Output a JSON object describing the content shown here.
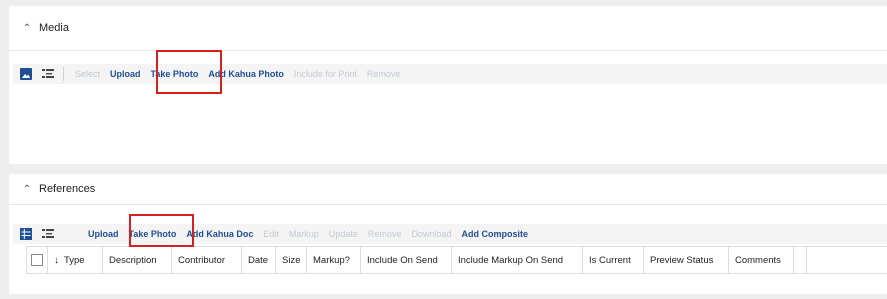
{
  "media": {
    "title": "Media",
    "toolbar": [
      {
        "label": "Select",
        "enabled": false,
        "bold": false
      },
      {
        "label": "Upload",
        "enabled": true,
        "bold": true
      },
      {
        "label": "Take Photo",
        "enabled": true,
        "bold": true
      },
      {
        "label": "Add Kahua Photo",
        "enabled": true,
        "bold": true
      },
      {
        "label": "Include for Print",
        "enabled": false,
        "bold": false
      },
      {
        "label": "Remove",
        "enabled": false,
        "bold": false
      }
    ]
  },
  "references": {
    "title": "References",
    "toolbar": [
      {
        "label": "Upload",
        "enabled": true,
        "bold": true
      },
      {
        "label": "Take Photo",
        "enabled": true,
        "bold": true
      },
      {
        "label": "Add Kahua Doc",
        "enabled": true,
        "bold": true
      },
      {
        "label": "Edit",
        "enabled": false,
        "bold": false
      },
      {
        "label": "Markup",
        "enabled": false,
        "bold": false
      },
      {
        "label": "Update",
        "enabled": false,
        "bold": false
      },
      {
        "label": "Remove",
        "enabled": false,
        "bold": false
      },
      {
        "label": "Download",
        "enabled": false,
        "bold": false
      },
      {
        "label": "Add Composite",
        "enabled": true,
        "bold": true
      }
    ],
    "columns": [
      "Type",
      "Description",
      "Contributor",
      "Date",
      "Size",
      "Markup?",
      "Include On Send",
      "Include Markup On Send",
      "Is Current",
      "Preview Status",
      "Comments",
      ""
    ]
  },
  "colors": {
    "link": "#1f4f93",
    "disabled": "#c2c9d3",
    "highlight": "#d61f1f",
    "icon_blue": "#1f4f93"
  },
  "icons": {
    "collapse": "chevron-up-icon",
    "gallery_view": "image-icon",
    "list_view": "list-view-icon",
    "grid_view": "grid-view-icon",
    "sort": "arrow-down-icon"
  }
}
